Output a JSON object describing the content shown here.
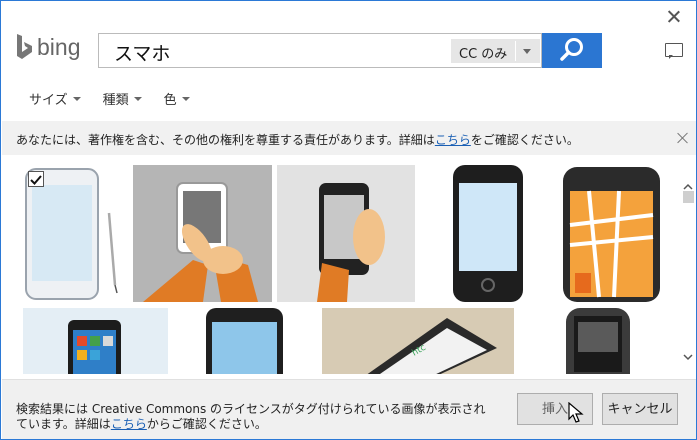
{
  "search": {
    "query": "スマホ",
    "filter_label": "CC のみ"
  },
  "filters": [
    {
      "label": "サイズ"
    },
    {
      "label": "種類"
    },
    {
      "label": "色"
    }
  ],
  "notice": {
    "text_before": "あなたには、著作権を含む、その他の権利を尊重する責任があります。詳細は",
    "link": "こちら",
    "text_after": "をご確認ください。"
  },
  "footer": {
    "text_before": "検索結果には Creative Commons のライセンスがタグ付けられている画像が表示されています。詳細は",
    "link": "こちら",
    "text_after": "からご確認ください。",
    "insert_label": "挿入",
    "cancel_label": "キャンセル"
  },
  "brand": {
    "logo": "bing",
    "accent": "#2b76d2",
    "link_color": "#1a5fb4"
  },
  "icons": [
    "close-icon",
    "bing-logo",
    "search-icon",
    "feedback-icon",
    "notice-close-icon",
    "checkbox-checked-icon",
    "scroll-up-icon",
    "scroll-down-icon",
    "cursor-icon"
  ]
}
